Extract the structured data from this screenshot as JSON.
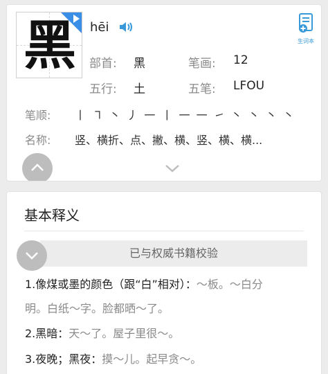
{
  "entry": {
    "character": "黑",
    "pinyin": "hēi"
  },
  "actions": {
    "vocab_label": "生词本"
  },
  "info": {
    "radical_label": "部首:",
    "radical_value": "黑",
    "strokes_label": "笔画:",
    "strokes_value": "12",
    "element_label": "五行:",
    "element_value": "土",
    "wubi_label": "五笔:",
    "wubi_value": "LFOU"
  },
  "stroke_order": {
    "label": "笔顺:",
    "value": "丨 ㇕ 丶 丿 一 丨 一 一 ㇀ 丶 丶 丶 丶"
  },
  "stroke_names": {
    "label": "名称:",
    "value": "竖、横折、点、撇、横、竖、横、横..."
  },
  "basic_meaning": {
    "title": "基本释义",
    "verify_text": "已与权威书籍校验",
    "definitions": [
      {
        "lead": "1.像煤或墨的颜色（跟“白”相对）：",
        "example": "～板。～白分"
      },
      {
        "lead": "",
        "example": "明。白纸～字。脸都晒～了。"
      },
      {
        "lead": "2.黑暗：",
        "example": "天～了。屋子里很～。"
      },
      {
        "lead": "3.夜晚；黑夜：",
        "example": "摸～儿。起早贪～。"
      }
    ]
  },
  "colors": {
    "accent": "#3a8ee6",
    "label_gray": "#8a8a8a",
    "background": "#ececec"
  }
}
